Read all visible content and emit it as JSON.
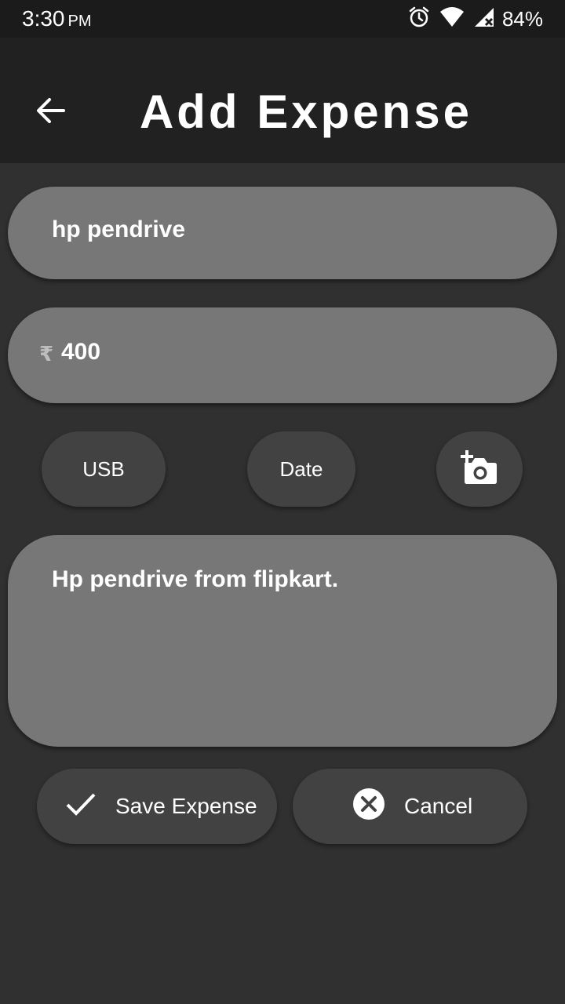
{
  "status_bar": {
    "time": "3:30",
    "ampm": "PM",
    "battery": "84%"
  },
  "app_bar": {
    "title": "Add Expense"
  },
  "form": {
    "title_value": "hp pendrive",
    "currency_symbol": "₹",
    "amount_value": "400",
    "category_label": "USB",
    "date_label": "Date",
    "notes_value": "Hp pendrive from flipkart."
  },
  "actions": {
    "save_label": "Save Expense",
    "cancel_label": "Cancel"
  },
  "colors": {
    "background": "#303030",
    "app_bar": "#212121",
    "field": "#777777",
    "button": "#424242"
  }
}
